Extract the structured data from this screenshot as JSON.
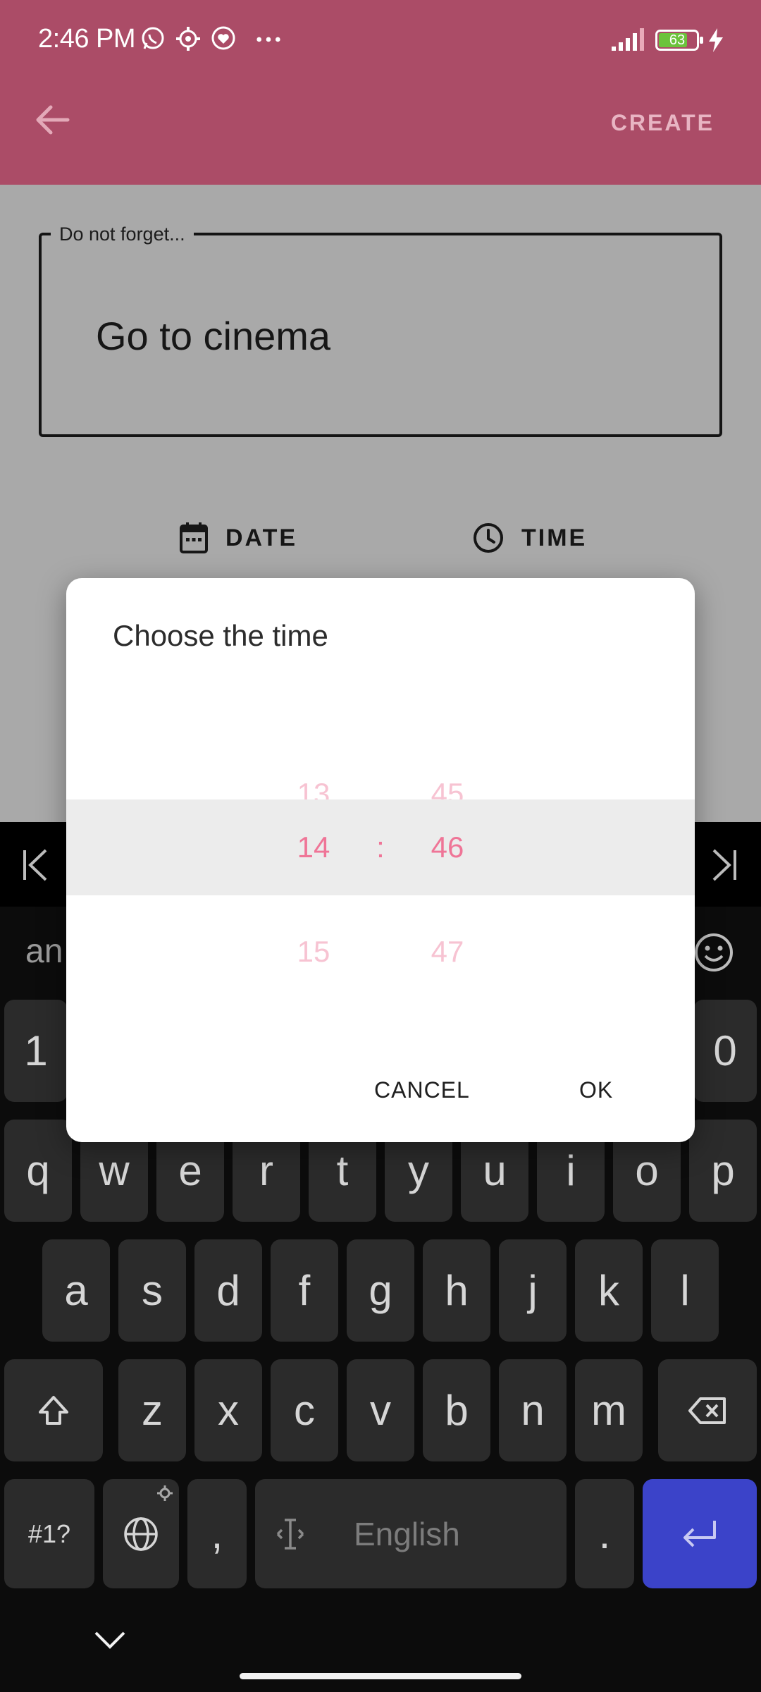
{
  "status_bar": {
    "time": "2:46 PM",
    "battery": "63"
  },
  "app_bar": {
    "create_label": "CREATE"
  },
  "form": {
    "field_label": "Do not forget...",
    "field_value": "Go to cinema",
    "date_label": "DATE",
    "time_label": "TIME"
  },
  "dialog": {
    "title": "Choose the time",
    "hours": [
      "13",
      "14",
      "15"
    ],
    "minutes": [
      "45",
      "46",
      "47"
    ],
    "separator": ":",
    "cancel_label": "CANCEL",
    "ok_label": "OK"
  },
  "keyboard": {
    "suggestion_partial": "an",
    "number_row": {
      "first": "1",
      "last": "0"
    },
    "row1": [
      "q",
      "w",
      "e",
      "r",
      "t",
      "y",
      "u",
      "i",
      "o",
      "p"
    ],
    "row2": [
      "a",
      "s",
      "d",
      "f",
      "g",
      "h",
      "j",
      "k",
      "l"
    ],
    "row3": [
      "z",
      "x",
      "c",
      "v",
      "b",
      "n",
      "m"
    ],
    "symbols_label": "#1?",
    "comma": ",",
    "space_label": "English",
    "period": "."
  },
  "colors": {
    "app_bar": "#ab4c67",
    "accent": "#ef7597",
    "enter_key": "#3b43c9"
  }
}
